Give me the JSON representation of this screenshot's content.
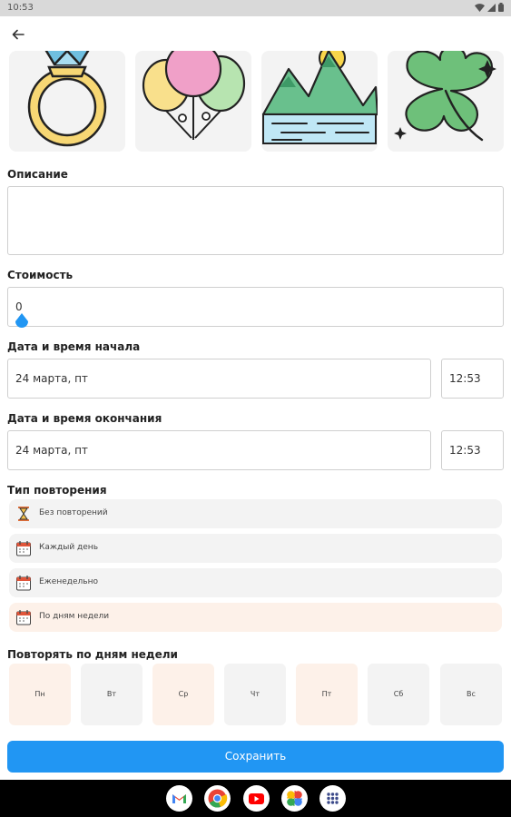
{
  "status_bar": {
    "time": "10:53"
  },
  "images": [
    {
      "icon": "ring-icon"
    },
    {
      "icon": "balloons-icon"
    },
    {
      "icon": "mountain-lake-icon"
    },
    {
      "icon": "clover-icon"
    }
  ],
  "description": {
    "label": "Описание",
    "value": ""
  },
  "cost": {
    "label": "Стоимость",
    "value": "0"
  },
  "start": {
    "label": "Дата и время начала",
    "date": "24 марта, пт",
    "time": "12:53"
  },
  "end": {
    "label": "Дата и время окончания",
    "date": "24 марта, пт",
    "time": "12:53"
  },
  "repeat": {
    "label": "Тип повторения",
    "options": [
      {
        "label": "Без повторений",
        "icon": "hourglass-icon"
      },
      {
        "label": "Каждый день",
        "icon": "calendar-icon"
      },
      {
        "label": "Еженедельно",
        "icon": "calendar-icon"
      },
      {
        "label": "По дням недели",
        "icon": "calendar-icon",
        "selected": true
      }
    ]
  },
  "weekdays": {
    "label": "Повторять по дням недели",
    "days": [
      {
        "label": "Пн",
        "selected": true
      },
      {
        "label": "Вт",
        "selected": false
      },
      {
        "label": "Ср",
        "selected": true
      },
      {
        "label": "Чт",
        "selected": false
      },
      {
        "label": "Пт",
        "selected": true
      },
      {
        "label": "Сб",
        "selected": false
      },
      {
        "label": "Вс",
        "selected": false
      }
    ]
  },
  "save_label": "Сохранить",
  "colors": {
    "accent": "#2196f3",
    "selected_bg": "#fdf1e9",
    "card_bg": "#f3f3f3"
  },
  "dock_apps": [
    "gmail-icon",
    "chrome-icon",
    "youtube-icon",
    "photos-icon",
    "app-drawer-icon"
  ]
}
